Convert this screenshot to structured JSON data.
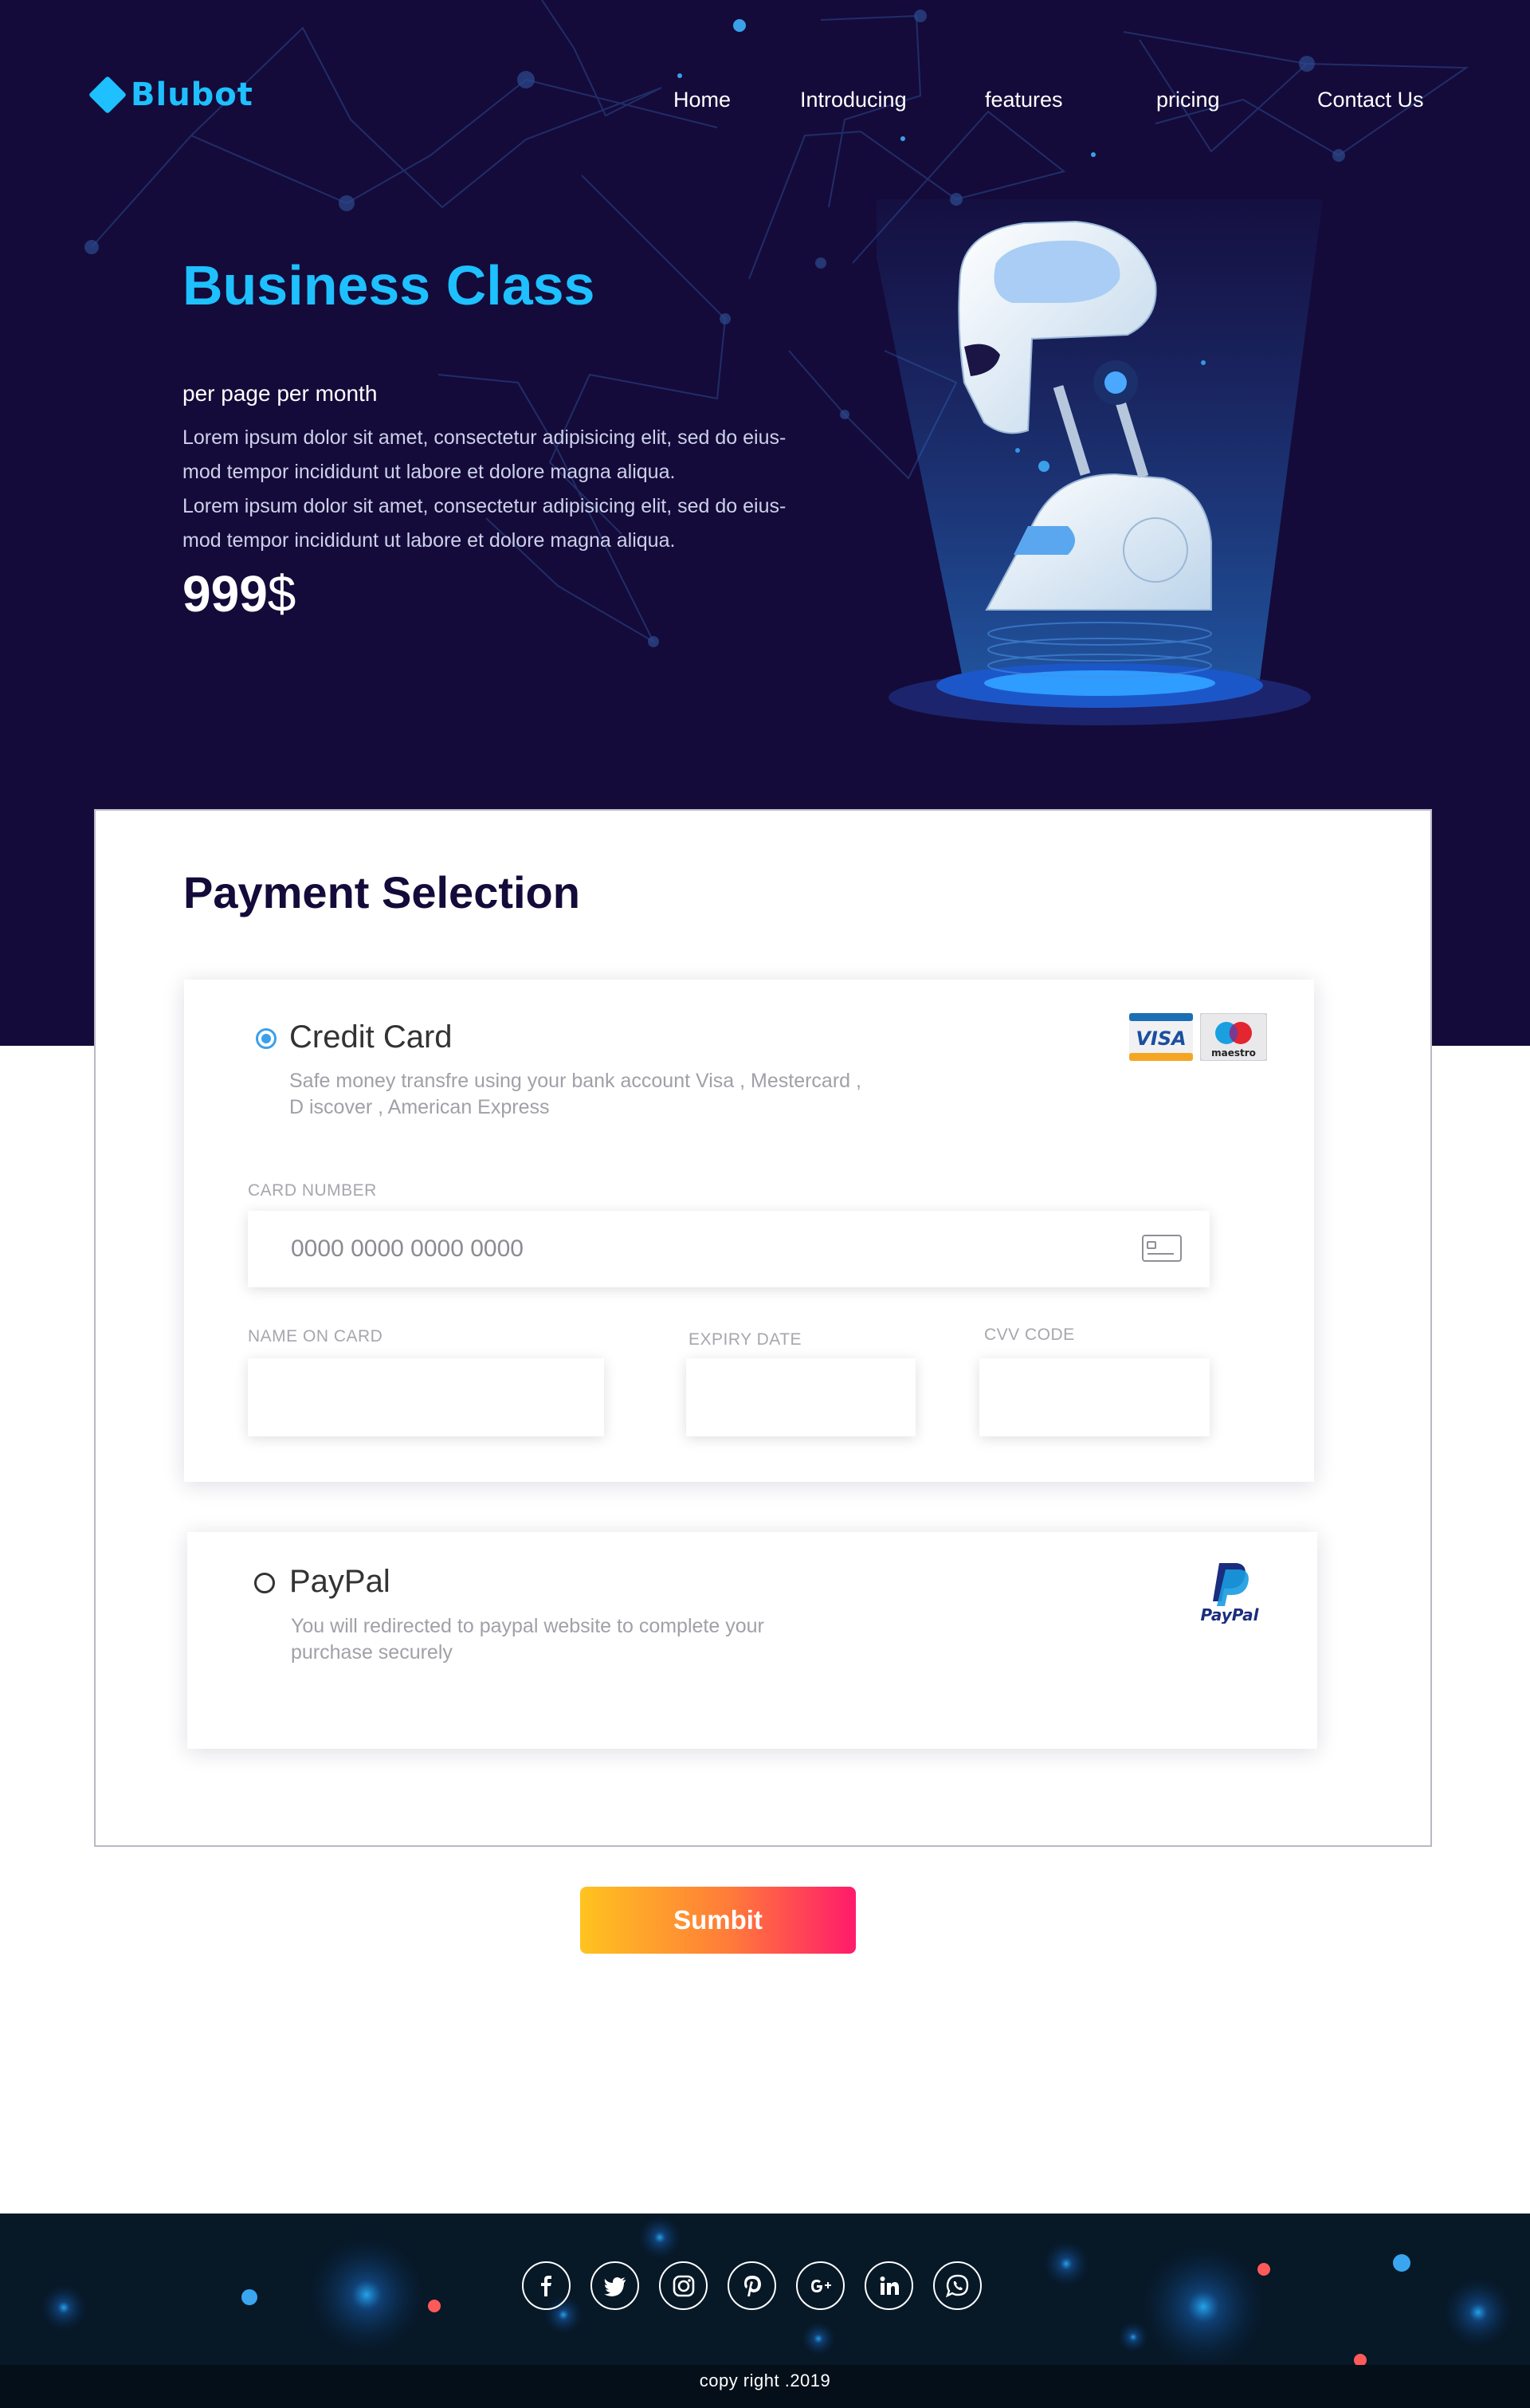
{
  "brand": {
    "name": "Blubot",
    "logo_icon": "diamond-logo-icon"
  },
  "nav": [
    "Home",
    "Introducing",
    "features",
    "pricing",
    "Contact Us"
  ],
  "hero": {
    "title": "Business Class",
    "subtitle": "per page per month",
    "description_lines": [
      "Lorem ipsum dolor sit amet, consectetur adipisicing elit, sed do eius-",
      "mod tempor incididunt ut labore et dolore magna aliqua.",
      "Lorem ipsum dolor sit amet, consectetur adipisicing elit, sed do eius-",
      "mod tempor incididunt ut labore et dolore magna aliqua."
    ],
    "price_value": "999",
    "price_currency": "$"
  },
  "payment": {
    "title": "Payment Selection",
    "credit_card": {
      "selected": true,
      "label": "Credit Card",
      "desc_line1": "Safe money transfre using your bank account Visa , Mestercard ,",
      "desc_line2": "D iscover , American Express",
      "brand_visa": "VISA",
      "brand_maestro": "maestro",
      "card_number_label": "CARD NUMBER",
      "card_number_placeholder": "0000 0000 0000 0000",
      "name_label": "NAME ON CARD",
      "expiry_label": "EXPIRY DATE",
      "cvv_label": "CVV CODE"
    },
    "paypal": {
      "selected": false,
      "label": "PayPal",
      "desc_line1": "You will redirected to paypal website to complete your",
      "desc_line2": "purchase securely",
      "logo_text": "PayPal"
    }
  },
  "submit_label": "Sumbit",
  "footer": {
    "socials": [
      "facebook-icon",
      "twitter-icon",
      "instagram-icon",
      "pinterest-icon",
      "google-plus-icon",
      "linkedin-icon",
      "whatsapp-icon"
    ],
    "copyright": "copy right .2019"
  },
  "colors": {
    "hero_bg": "#140b3a",
    "accent": "#1ec0ff",
    "radio_selected": "#3aa0ea",
    "submit_gradient": [
      "#ffc31f",
      "#ff1a6c"
    ],
    "footer_bg": "#071827"
  }
}
